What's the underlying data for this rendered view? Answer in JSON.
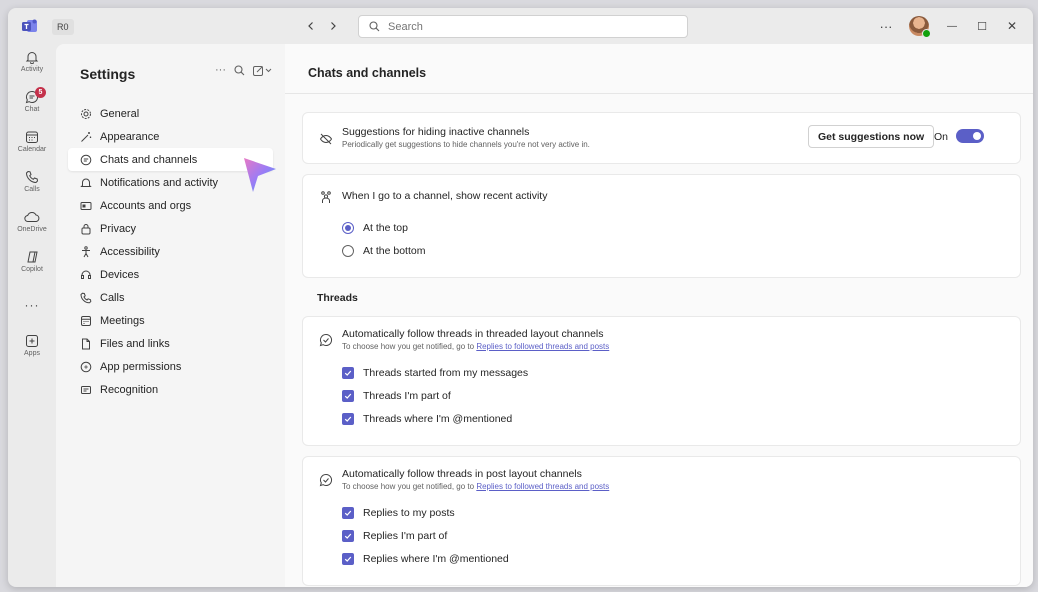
{
  "titlebar": {
    "account_badge": "R0",
    "search_placeholder": "Search",
    "more_label": "···",
    "minimize": "—",
    "maximize": "☐",
    "close": "✕"
  },
  "rail": {
    "items": [
      {
        "label": "Activity",
        "icon": "bell-icon"
      },
      {
        "label": "Chat",
        "icon": "chat-icon",
        "badge": "5"
      },
      {
        "label": "Calendar",
        "icon": "calendar-icon"
      },
      {
        "label": "Calls",
        "icon": "phone-icon"
      },
      {
        "label": "OneDrive",
        "icon": "cloud-icon"
      },
      {
        "label": "Copilot",
        "icon": "copilot-icon"
      },
      {
        "label": "",
        "icon": "more-icon"
      },
      {
        "label": "Apps",
        "icon": "add-apps-icon"
      }
    ],
    "more_glyph": "···"
  },
  "settings": {
    "title": "Settings",
    "more_label": "···",
    "items": [
      {
        "label": "General",
        "icon": "gear-icon"
      },
      {
        "label": "Appearance",
        "icon": "wand-icon"
      },
      {
        "label": "Chats and channels",
        "icon": "chat-bubble-icon",
        "selected": true
      },
      {
        "label": "Notifications and activity",
        "icon": "bell-icon"
      },
      {
        "label": "Accounts and orgs",
        "icon": "id-card-icon"
      },
      {
        "label": "Privacy",
        "icon": "lock-icon"
      },
      {
        "label": "Accessibility",
        "icon": "accessibility-icon"
      },
      {
        "label": "Devices",
        "icon": "headset-icon"
      },
      {
        "label": "Calls",
        "icon": "phone-icon"
      },
      {
        "label": "Meetings",
        "icon": "calendar-icon"
      },
      {
        "label": "Files and links",
        "icon": "document-icon"
      },
      {
        "label": "App permissions",
        "icon": "shield-icon"
      },
      {
        "label": "Recognition",
        "icon": "badge-icon"
      }
    ]
  },
  "main": {
    "title": "Chats and channels",
    "suggestions": {
      "title": "Suggestions for hiding inactive channels",
      "subtitle": "Periodically get suggestions to hide channels you're not very active in.",
      "button": "Get suggestions now",
      "toggle_label": "On",
      "toggle_on": true
    },
    "recent_activity": {
      "title": "When I go to a channel, show recent activity",
      "options": [
        {
          "label": "At the top",
          "checked": true
        },
        {
          "label": "At the bottom",
          "checked": false
        }
      ]
    },
    "threads_heading": "Threads",
    "threaded_layout": {
      "title": "Automatically follow threads in threaded layout channels",
      "subtitle_prefix": "To choose how you get notified, go to ",
      "link": "Replies to followed threads and posts",
      "options": [
        {
          "label": "Threads started from my messages",
          "checked": true
        },
        {
          "label": "Threads I'm part of",
          "checked": true
        },
        {
          "label": "Threads where I'm @mentioned",
          "checked": true
        }
      ]
    },
    "post_layout": {
      "title": "Automatically follow threads in post layout channels",
      "subtitle_prefix": "To choose how you get notified, go to ",
      "link": "Replies to followed threads and posts",
      "options": [
        {
          "label": "Replies to my posts",
          "checked": true
        },
        {
          "label": "Replies I'm part of",
          "checked": true
        },
        {
          "label": "Replies where I'm @mentioned",
          "checked": true
        }
      ]
    }
  },
  "colors": {
    "accent": "#5b5fc7",
    "badge": "#c4314b",
    "presence": "#13a10e"
  }
}
